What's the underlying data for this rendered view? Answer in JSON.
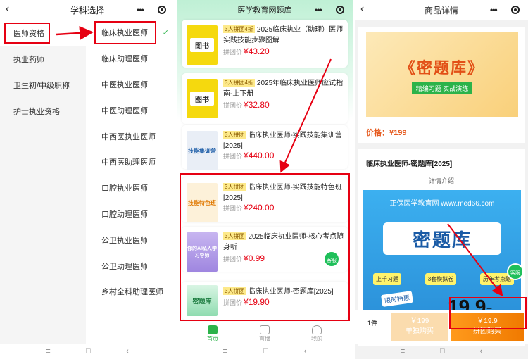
{
  "screen1": {
    "title": "学科选择",
    "categories": [
      {
        "label": "医师资格",
        "active": true
      },
      {
        "label": "执业药师"
      },
      {
        "label": "卫生初/中级职称"
      },
      {
        "label": "护士执业资格"
      }
    ],
    "subjects": [
      {
        "label": "临床执业医师",
        "selected": true
      },
      {
        "label": "临床助理医师"
      },
      {
        "label": "中医执业医师"
      },
      {
        "label": "中医助理医师"
      },
      {
        "label": "中西医执业医师"
      },
      {
        "label": "中西医助理医师"
      },
      {
        "label": "口腔执业医师"
      },
      {
        "label": "口腔助理医师"
      },
      {
        "label": "公卫执业医师"
      },
      {
        "label": "公卫助理医师"
      },
      {
        "label": "乡村全科助理医师"
      }
    ],
    "check_glyph": "✓"
  },
  "screen2": {
    "title": "医学教育网题库",
    "price_label": "拼团价",
    "products": [
      {
        "badge": "3人拼团4折",
        "name": "2025临床执业（助理）医师实践技能步骤图解",
        "price": "¥43.20",
        "thumb_text": "图书"
      },
      {
        "badge": "3人拼团4折",
        "name": "2025年临床执业医师应试指南-上下册",
        "price": "¥32.80",
        "thumb_text": "图书"
      },
      {
        "badge": "3人拼团",
        "name": "临床执业医师-实践技能集训营[2025]",
        "price": "¥440.00",
        "thumb_text": "技能集训营"
      },
      {
        "badge": "3人拼团",
        "name": "临床执业医师-实践技能特色班[2025]",
        "price": "¥240.00",
        "thumb_text": "技能特色班"
      },
      {
        "badge": "3人拼团",
        "name": "2025临床执业医师-核心考点随身听",
        "price": "¥0.99",
        "thumb_text": "你的AI私人学习导师"
      },
      {
        "badge": "3人拼团",
        "name": "临床执业医师-密题库[2025]",
        "price": "¥19.90",
        "thumb_text": "密题库"
      }
    ],
    "kefu_label": "客服",
    "tabs": [
      {
        "label": "首页",
        "active": true
      },
      {
        "label": "直播"
      },
      {
        "label": "我的"
      }
    ]
  },
  "screen3": {
    "title": "商品详情",
    "banner_title": "《密题库》",
    "banner_sub": "精编习题 实战演练",
    "price": "价格：¥199",
    "product_name": "临床执业医师-密题库[2025]",
    "intro": "详情介绍",
    "poster": {
      "brand": "正保医学教育网 www.med66.com",
      "big": "密题库",
      "pills": [
        "上千习题",
        "3套模拟卷",
        "历年考点题"
      ],
      "sale": "限时特惠",
      "num": "19.9",
      "unit": "元"
    },
    "kefu_label": "客服",
    "qty": "1件",
    "single_price": "￥199",
    "single_label": "单独购买",
    "group_price": "￥19.9",
    "group_label": "拼团购买"
  },
  "sysnav": {
    "menu": "≡",
    "home": "□",
    "back": "‹"
  },
  "colors": {
    "highlight": "#e60012",
    "accent": "#2cb34a",
    "orange": "#f07a00"
  }
}
